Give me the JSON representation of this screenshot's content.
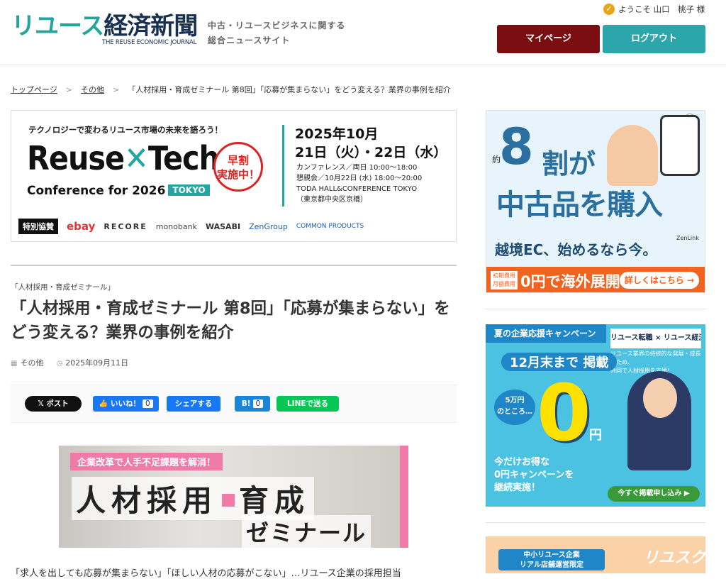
{
  "header": {
    "logo_teal": "リユース",
    "logo_navy": "経済新聞",
    "logo_sub": "THE REUSE ECONOMIC JOURNAL",
    "tagline_line1": "中古・リユースビジネスに関する",
    "tagline_line2": "総合ニュースサイト",
    "welcome": "ようこそ 山口　桃子 様",
    "mypage_label": "マイページ",
    "logout_label": "ログアウト"
  },
  "breadcrumb": {
    "home": "トップページ",
    "category": "その他",
    "current": "「人材採用・育成ゼミナール 第8回」「応募が集まらない」をどう変える？業界の事例を紹介"
  },
  "hero_banner": {
    "tagline": "テクノロジーで変わるリユース市場の未来を語ろう！",
    "reuse": "Reuse",
    "x": "✕",
    "tech": "Tech",
    "conference": "Conference for 2026",
    "tokyo": "TOKYO",
    "badge": "早割\n実施中！",
    "date_line1": "2025年10月",
    "date_line2": "21日（火）・22日（水）",
    "info_1": "カンファレンス／両日 10:00～18:00",
    "info_2": "懇親会／10月22日 (水) 18:00～20:00",
    "info_3": "TODA HALL&CONFERENCE TOKYO",
    "info_4": "（東京都中央区京橋）",
    "sponsor_label": "特別協賛",
    "sponsors": [
      "ebay",
      "RECORE",
      "monobank",
      "WASABI",
      "ZenGroup",
      "COMMON PRODUCTS"
    ]
  },
  "article": {
    "category": "「人材採用・育成ゼミナール」",
    "title": "「人材採用・育成ゼミナール 第8回」「応募が集まらない」をどう変える？業界の事例を紹介",
    "meta_category": "その他",
    "date": "2025年09月11日",
    "body_start": "「求人を出しても応募が集まらない」「ほしい人材の応募がこない」…リユース企業の採用担当"
  },
  "share": {
    "x_label": "ポスト",
    "like_label": "いいね！",
    "like_count": "0",
    "share_label": "シェアする",
    "hatena_label": "B!",
    "hatena_count": "0",
    "line_label": "LINEで送る"
  },
  "eyecatch": {
    "ribbon": "企業改革で人手不足課題を解消！",
    "big_left": "人材採用",
    "big_right": "育成",
    "seminar": "ゼミナール"
  },
  "sidebar": {
    "ad1": {
      "yaku": "約",
      "eight": "8",
      "wari": "割が",
      "kounyu": "中古品を購入",
      "ec": "越境EC、始めるなら今。",
      "fee": "初期費用\n月額費用",
      "zero": "0円で海外展開",
      "more": "詳しくはこちら →",
      "brand": "ZenLink",
      "info": "i"
    },
    "ad2": {
      "campaign": "夏の企業応援キャンペーン",
      "logo": "リユース転職 × リユース経済新聞",
      "desc": "リユース業界の持続的な発展・成長のため、\n共同で人材採用を支援！",
      "month": "12月末まで 掲載",
      "was": "5万円\nのところ…",
      "zero": "0",
      "yen": "円",
      "bottom": "今だけお得な\n0円キャンペーンを\n継続実施！",
      "cta": "今すぐ掲載申し込み ▶"
    },
    "ad3": {
      "tag": "中小リユース企業\nリアル店舗運営限定",
      "logo": "リユスク"
    }
  }
}
